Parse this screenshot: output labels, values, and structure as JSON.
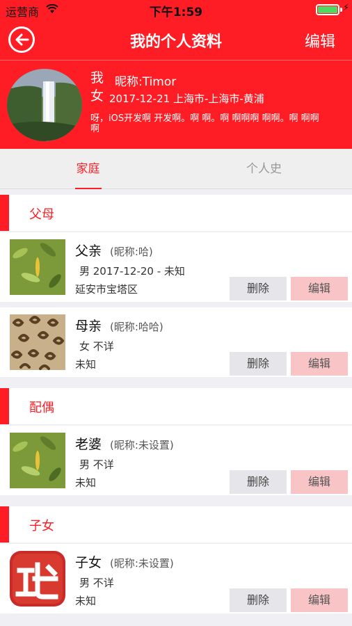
{
  "status_bar": {
    "carrier": "运营商",
    "time": "下午1:59",
    "battery_level": 1.0
  },
  "nav": {
    "title": "我的个人资料",
    "edit_label": "编辑"
  },
  "profile": {
    "gender_char_1": "我",
    "gender_char_2": "女",
    "nickname": "昵称:Timor",
    "info": "2017-12-21  上海市-上海市-黄浦",
    "bio": "呀，iOS开发啊 开发啊。啊 啊。啊 啊啊啊 啊啊。啊 啊啊啊"
  },
  "tabs": [
    {
      "label": "家庭",
      "active": true
    },
    {
      "label": "个人史",
      "active": false
    }
  ],
  "sections": [
    {
      "title": "父母",
      "members": [
        {
          "name": "父亲",
          "nick": "(昵称:哈)",
          "meta": "男  2017-12-20 - 未知",
          "addr": "延安市宝塔区",
          "photo": "leaves"
        },
        {
          "name": "母亲",
          "nick": "(昵称:哈哈)",
          "meta": "女  不详",
          "addr": "未知",
          "photo": "pattern"
        }
      ]
    },
    {
      "title": "配偶",
      "members": [
        {
          "name": "老婆",
          "nick": "(昵称:未设置)",
          "meta": "男  不详",
          "addr": "未知",
          "photo": "leaves"
        }
      ]
    },
    {
      "title": "子女",
      "members": [
        {
          "name": "子女",
          "nick": "(昵称:未设置)",
          "meta": "男  不详",
          "addr": "未知",
          "photo": "app-logo"
        }
      ]
    }
  ],
  "actions": {
    "delete_label": "删除",
    "edit_label": "编辑"
  },
  "colors": {
    "primary": "#ff1d25",
    "edit_button_bg": "#f9c4c6",
    "delete_button_bg": "#e6e6ea"
  }
}
